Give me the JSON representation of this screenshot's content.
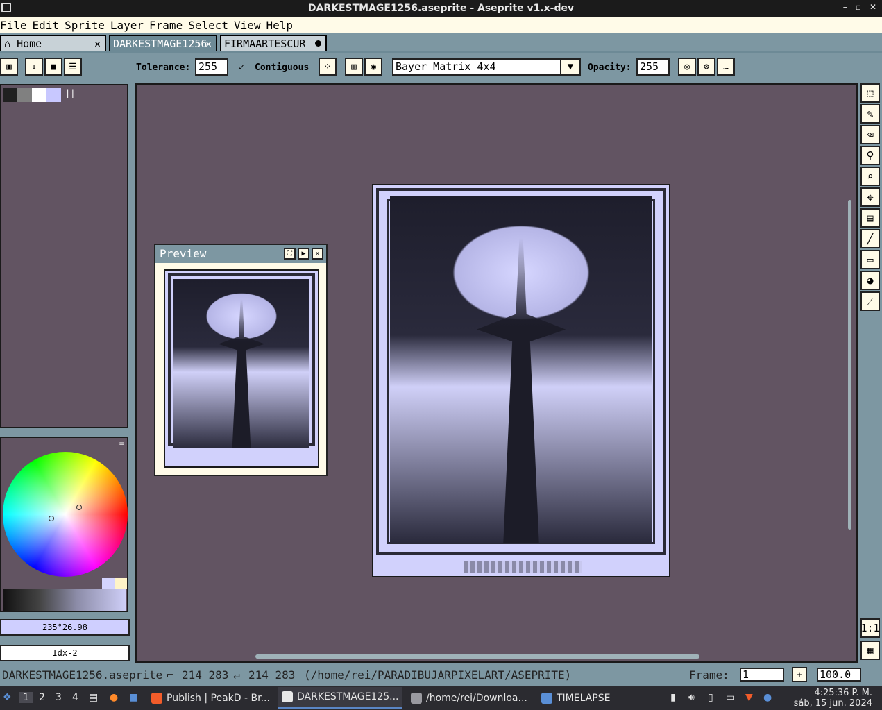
{
  "window": {
    "title": "DARKESTMAGE1256.aseprite - Aseprite v1.x-dev",
    "controls": [
      "–",
      "▫",
      "✕"
    ]
  },
  "menu": [
    "File",
    "Edit",
    "Sprite",
    "Layer",
    "Frame",
    "Select",
    "View",
    "Help"
  ],
  "tabs": {
    "home": "Home",
    "active": "DARKESTMAGE1256",
    "other": "FIRMAARTESCUR"
  },
  "context_bar": {
    "tolerance_label": "Tolerance:",
    "tolerance_value": "255",
    "contiguous_label": "Contiguous",
    "contiguous_checked": true,
    "dither_value": "Bayer Matrix 4x4",
    "opacity_label": "Opacity:",
    "opacity_value": "255"
  },
  "palette": {
    "swatches": [
      "#202020",
      "#808080",
      "#ffffff",
      "#c8c8ff"
    ],
    "bars": "||"
  },
  "color": {
    "hex": "235°26.98",
    "index": "Idx-2"
  },
  "preview": {
    "title": "Preview"
  },
  "status": {
    "filename": "DARKESTMAGE1256.aseprite",
    "size": "214 283",
    "pos": "214 283",
    "path": "(/home/rei/PARADIBUJARPIXELART/ASEPRITE)",
    "frame_label": "Frame:",
    "frame_value": "1",
    "zoom": "100.0"
  },
  "taskbar": {
    "workspaces": [
      "1",
      "2",
      "3",
      "4"
    ],
    "tasks": [
      {
        "label": "Publish | PeakD - Br...",
        "color": "#f25c2a"
      },
      {
        "label": "DARKESTMAGE125...",
        "color": "#e8e8e8"
      },
      {
        "label": "/home/rei/Downloa...",
        "color": "#9a9aa0"
      },
      {
        "label": "TIMELAPSE",
        "color": "#5a8fd6"
      }
    ],
    "clock_time": "4:25:36 P. M.",
    "clock_date": "sáb, 15 jun. 2024"
  },
  "colors": {
    "canvas_bg": "#625462",
    "ui_bg": "#7d97a2",
    "sprite_light": "#d1d1fc",
    "sprite_dark": "#2a2a36"
  }
}
